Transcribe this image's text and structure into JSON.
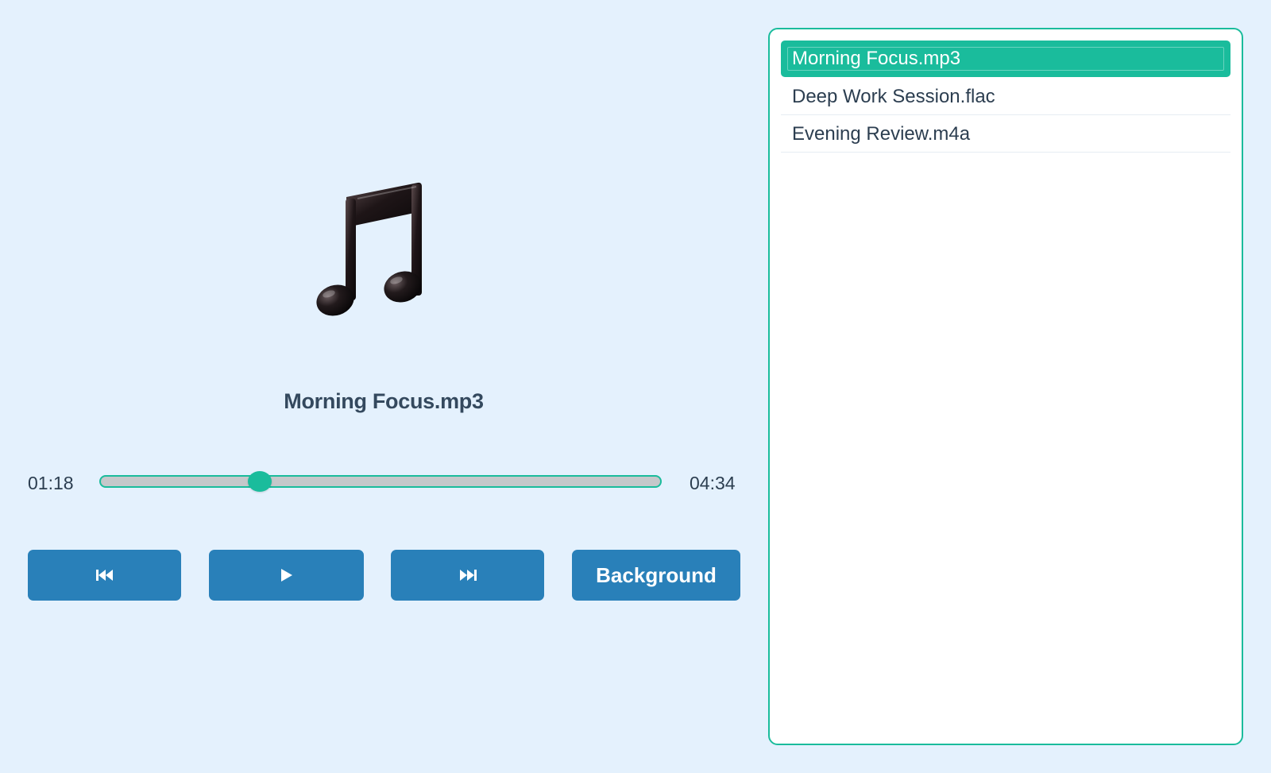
{
  "player": {
    "artwork_icon": "musical-notes-icon",
    "title": "Morning Focus.mp3",
    "current_time": "01:18",
    "total_time": "04:34",
    "progress_fraction": 0.2847,
    "controls": {
      "prev_icon": "skip-previous-icon",
      "play_icon": "play-icon",
      "next_icon": "skip-next-icon",
      "background_label": "Background"
    }
  },
  "playlist": {
    "items": [
      {
        "label": "Morning Focus.mp3",
        "active": true
      },
      {
        "label": "Deep Work Session.flac",
        "active": false
      },
      {
        "label": "Evening Review.m4a",
        "active": false
      }
    ]
  },
  "colors": {
    "page_background": "#e4f1fd",
    "accent": "#1abc9c",
    "button": "#2980b9",
    "text": "#2c3e50",
    "track": "#c5c8ca"
  }
}
